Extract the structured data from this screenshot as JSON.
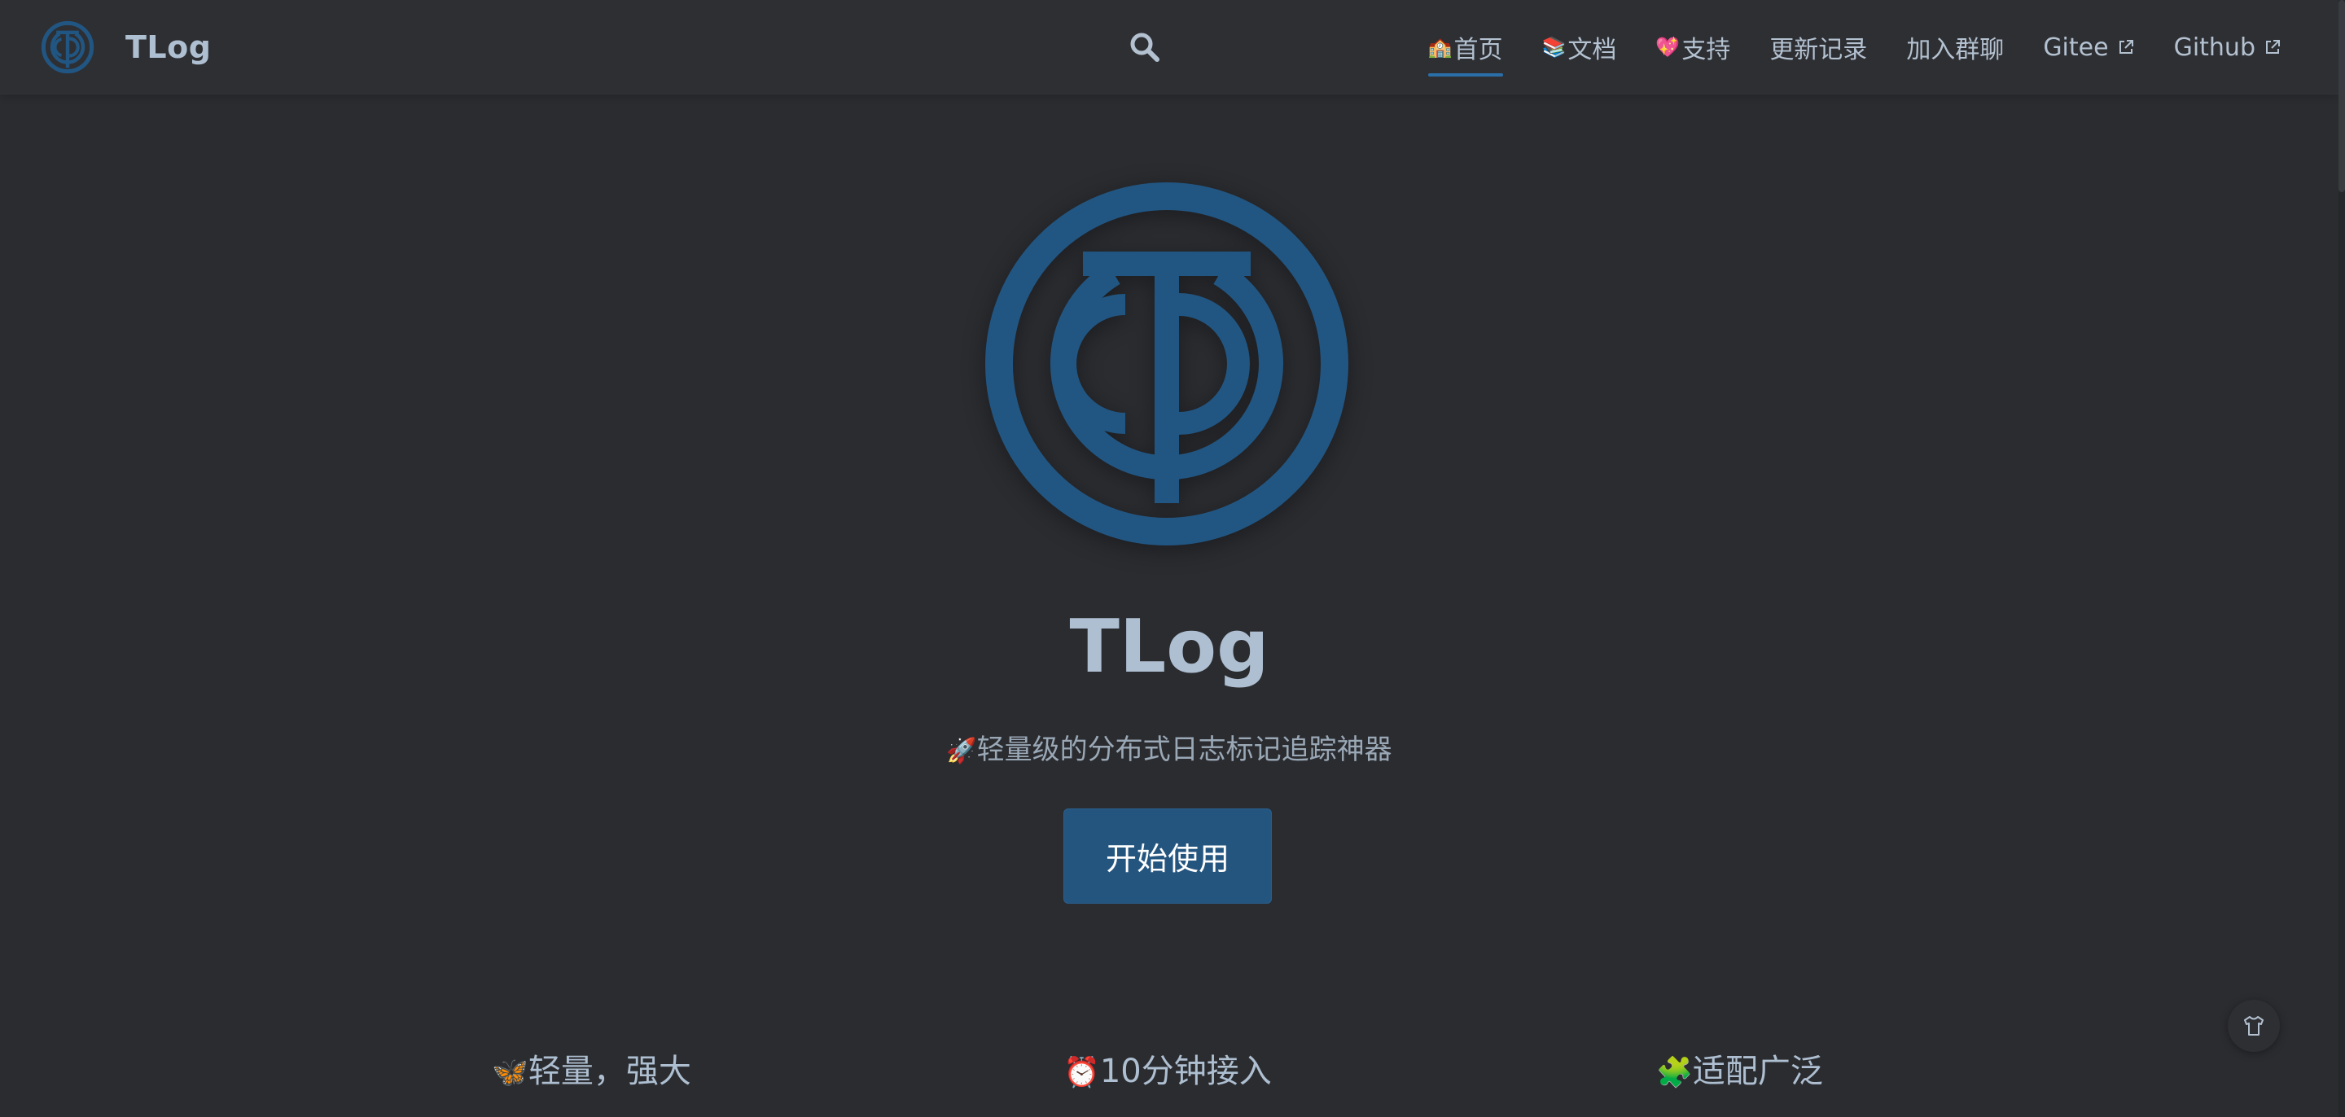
{
  "brand": {
    "title": "TLog",
    "logo_icon": "tlog-logo-icon"
  },
  "search": {
    "icon": "search-icon"
  },
  "nav": {
    "items": [
      {
        "emoji": "🏫",
        "label": "首页",
        "active": true
      },
      {
        "emoji": "📚",
        "label": "文档"
      },
      {
        "emoji": "💖",
        "label": "支持"
      },
      {
        "label": "更新记录"
      },
      {
        "label": "加入群聊"
      },
      {
        "label": "Gitee",
        "icon": "external-link-icon"
      },
      {
        "label": "Github",
        "icon": "external-link-icon"
      }
    ]
  },
  "hero": {
    "title": "TLog",
    "desc_emoji": "🚀",
    "description": "轻量级的分布式日志标记追踪神器",
    "action_label": "开始使用"
  },
  "features": [
    {
      "emoji": "🦋",
      "title": "轻量，强大"
    },
    {
      "emoji": "⏰",
      "title": "10分钟接入"
    },
    {
      "emoji": "🧩",
      "title": "适配广泛"
    }
  ],
  "colors": {
    "background": "#2b2c30",
    "navbar": "#2e2f33",
    "accent": "#24557f",
    "logo": "#215683",
    "text": "#aebfd1"
  },
  "floating": {
    "icon": "shirt-icon"
  }
}
